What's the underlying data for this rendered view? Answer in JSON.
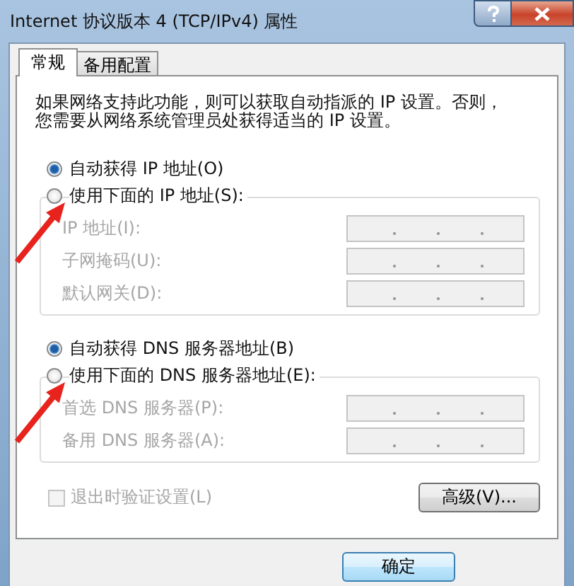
{
  "window": {
    "title": "Internet 协议版本 4 (TCP/IPv4) 属性"
  },
  "tabs": [
    {
      "label": "常规",
      "selected": true
    },
    {
      "label": "备用配置",
      "selected": false
    }
  ],
  "description": "如果网络支持此功能，则可以获取自动指派的 IP 设置。否则，您需要从网络系统管理员处获得适当的 IP 设置。",
  "ip_section": {
    "options": [
      {
        "label": "自动获得 IP 地址(O)",
        "selected": true
      },
      {
        "label": "使用下面的 IP 地址(S):",
        "selected": false,
        "annotated": true
      }
    ],
    "fields": [
      {
        "label": "IP 地址(I):",
        "disabled": true
      },
      {
        "label": "子网掩码(U):",
        "disabled": true
      },
      {
        "label": "默认网关(D):",
        "disabled": true
      }
    ]
  },
  "dns_section": {
    "options": [
      {
        "label": "自动获得 DNS 服务器地址(B)",
        "selected": true
      },
      {
        "label": "使用下面的 DNS 服务器地址(E):",
        "selected": false,
        "annotated": true
      }
    ],
    "fields": [
      {
        "label": "首选 DNS 服务器(P):",
        "disabled": true
      },
      {
        "label": "备用 DNS 服务器(A):",
        "disabled": true
      }
    ]
  },
  "validate_on_exit": {
    "label": "退出时验证设置(L)",
    "checked": false,
    "disabled": true
  },
  "advanced_button": "高级(V)...",
  "ok_button": "确定"
}
